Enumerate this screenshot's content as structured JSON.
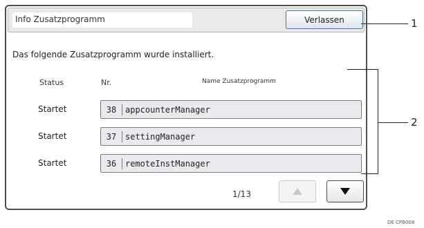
{
  "dialog": {
    "title": "Info Zusatzprogramm",
    "exit_label": "Verlassen",
    "message": "Das folgende Zusatzprogramm wurde installiert."
  },
  "table": {
    "headers": {
      "status": "Status",
      "number": "Nr.",
      "name": "Name Zusatzprogramm"
    },
    "rows": [
      {
        "status": "Startet",
        "number": "38",
        "name": "appcounterManager"
      },
      {
        "status": "Startet",
        "number": "37",
        "name": "settingManager"
      },
      {
        "status": "Startet",
        "number": "36",
        "name": "remoteInstManager"
      }
    ]
  },
  "pagination": {
    "indicator": "1/13",
    "up_icon": "triangle-up-icon",
    "down_icon": "triangle-down-icon"
  },
  "callouts": {
    "one": "1",
    "two": "2"
  },
  "footer_code": "DE CPB008",
  "colors": {
    "panel_border": "#4d4d4d",
    "button_border": "#4a6f9a",
    "field_bg": "#e9e9ee",
    "disabled_arrow": "#c8c8c8"
  }
}
